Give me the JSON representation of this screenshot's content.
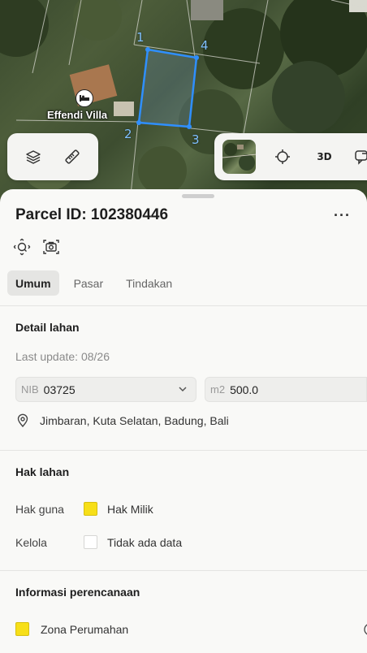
{
  "map": {
    "poi_label": "Effendi Villa",
    "vertex_labels": [
      "1",
      "2",
      "3",
      "4"
    ],
    "layers_icon": "layers-icon",
    "measure_icon": "ruler-icon",
    "locate_icon": "crosshair-icon",
    "three_d_label": "3D",
    "share_icon": "chat-share-icon",
    "parcel_color": "#2f8fff"
  },
  "sheet": {
    "title": "Parcel ID: 102380446",
    "more_label": "···",
    "tabs": [
      {
        "label": "Umum",
        "active": true
      },
      {
        "label": "Pasar",
        "active": false
      },
      {
        "label": "Tindakan",
        "active": false
      }
    ],
    "detail": {
      "title": "Detail lahan",
      "last_update": "Last update: 08/26",
      "nib_prefix": "NIB",
      "nib_value": "03725",
      "area_prefix": "m2",
      "area_value": "500.0",
      "address": "Jimbaran, Kuta Selatan, Badung, Bali"
    },
    "rights": {
      "title": "Hak lahan",
      "rows": [
        {
          "key": "Hak guna",
          "value": "Hak Milik",
          "swatch": "#f7df18"
        },
        {
          "key": "Kelola",
          "value": "Tidak ada data",
          "swatch": "#ffffff"
        }
      ]
    },
    "planning": {
      "title": "Informasi perencanaan",
      "zone": "Zona Perumahan",
      "zone_color": "#f7df18"
    }
  }
}
